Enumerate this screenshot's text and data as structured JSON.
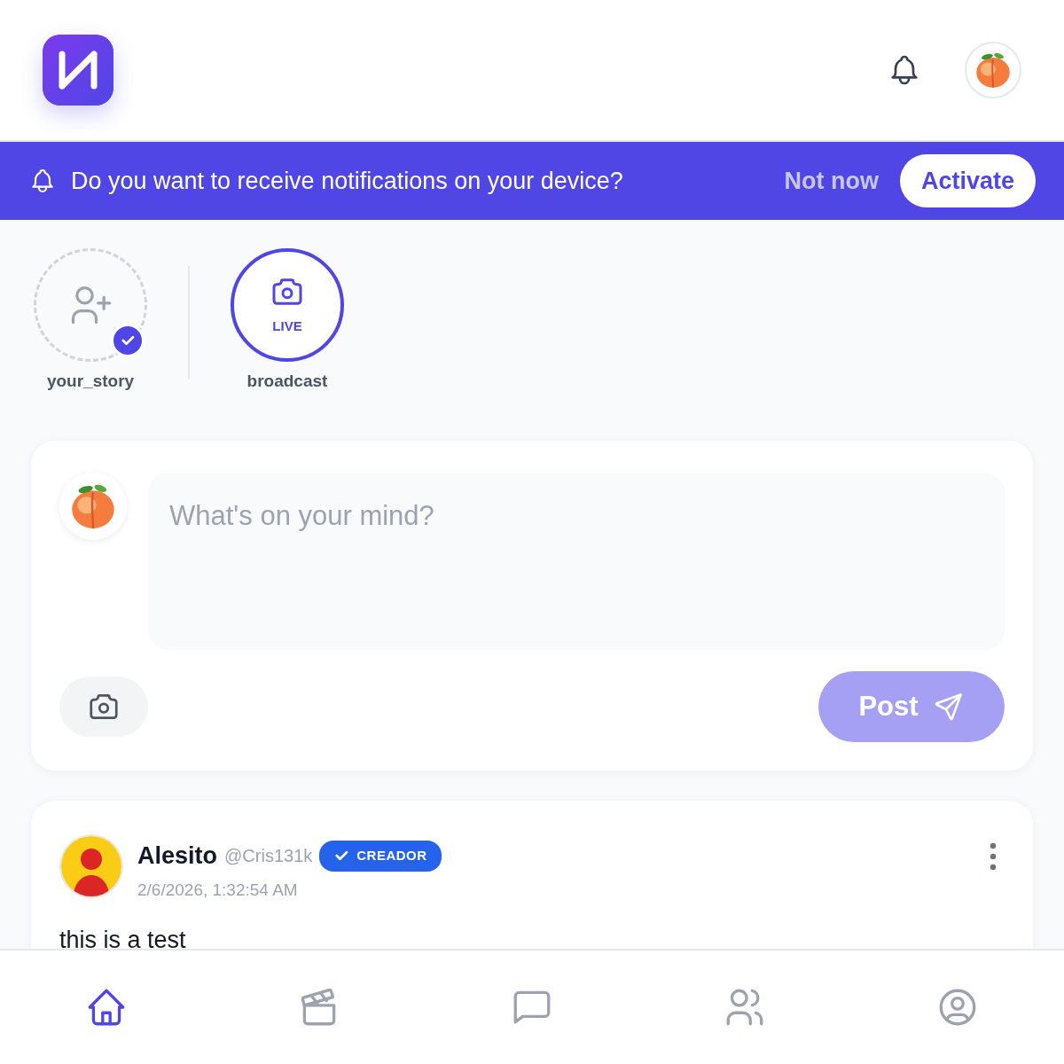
{
  "banner": {
    "message": "Do you want to receive notifications on your device?",
    "dismiss": "Not now",
    "accept": "Activate"
  },
  "stories": [
    {
      "kind": "add",
      "label": "your_story",
      "checked": true
    },
    {
      "kind": "live",
      "badge": "LIVE",
      "label": "broadcast"
    }
  ],
  "composer": {
    "placeholder": "What's on your mind?",
    "post_button": "Post",
    "disabled": true
  },
  "posts": [
    {
      "name": "Alesito",
      "handle": "@Cris131k",
      "badge": "CREADOR",
      "time": "2/6/2026, 1:32:54 AM",
      "text": "this is a test"
    }
  ],
  "nav": [
    {
      "kind": "home",
      "selected": true
    },
    {
      "kind": "clips",
      "selected": false
    },
    {
      "kind": "messages",
      "selected": false
    },
    {
      "kind": "friends",
      "selected": false
    },
    {
      "kind": "profile",
      "selected": false
    }
  ]
}
